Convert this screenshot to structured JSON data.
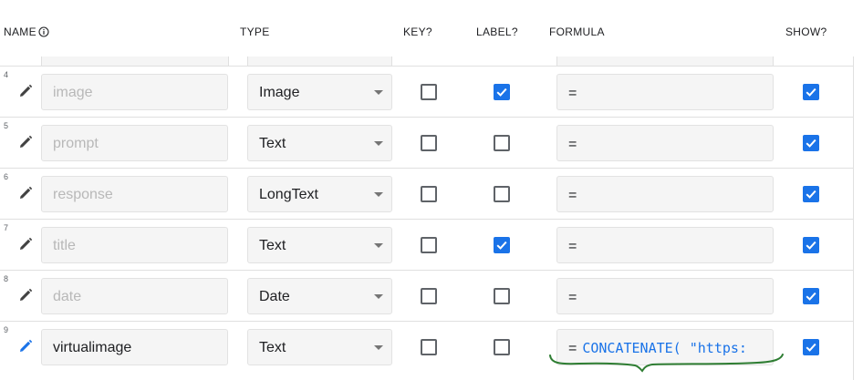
{
  "headers": {
    "name": "NAME",
    "type": "TYPE",
    "key": "KEY?",
    "label": "LABEL?",
    "formula": "FORMULA",
    "show": "SHOW?"
  },
  "rows": [
    {
      "num": "4",
      "name": "image",
      "type": "Image",
      "key": false,
      "label": true,
      "formula_prefix": "=",
      "formula_expr": "",
      "show": true,
      "active": false
    },
    {
      "num": "5",
      "name": "prompt",
      "type": "Text",
      "key": false,
      "label": false,
      "formula_prefix": "=",
      "formula_expr": "",
      "show": true,
      "active": false
    },
    {
      "num": "6",
      "name": "response",
      "type": "LongText",
      "key": false,
      "label": false,
      "formula_prefix": "=",
      "formula_expr": "",
      "show": true,
      "active": false
    },
    {
      "num": "7",
      "name": "title",
      "type": "Text",
      "key": false,
      "label": true,
      "formula_prefix": "=",
      "formula_expr": "",
      "show": true,
      "active": false
    },
    {
      "num": "8",
      "name": "date",
      "type": "Date",
      "key": false,
      "label": false,
      "formula_prefix": "=",
      "formula_expr": "",
      "show": true,
      "active": false
    },
    {
      "num": "9",
      "name": "virtualimage",
      "type": "Text",
      "key": false,
      "label": false,
      "formula_prefix": "=",
      "formula_expr": "CONCATENATE(  \"https:",
      "show": true,
      "active": true
    }
  ],
  "colors": {
    "checkbox_checked": "#1a73e8",
    "pencil_default": "#424242",
    "pencil_active": "#1a73e8",
    "annotation": "#2e7d32",
    "field_bg": "#f5f5f5"
  },
  "icons": {
    "header_info": "info-icon",
    "row_edit": "pencil-icon",
    "type_dropdown": "caret-down-icon",
    "checkbox_checked": "check-icon"
  }
}
